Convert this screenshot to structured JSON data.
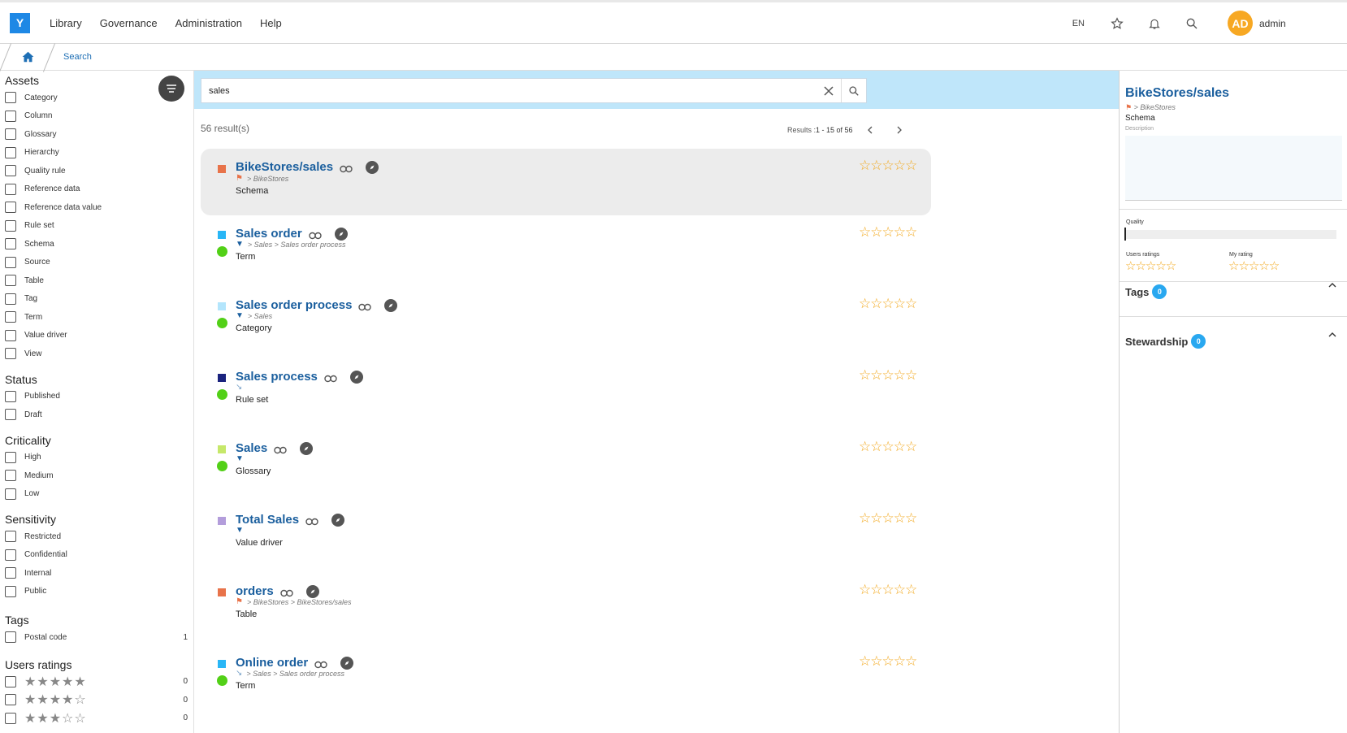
{
  "app": {
    "logo": "Y"
  },
  "menu": [
    "Library",
    "Governance",
    "Administration",
    "Help"
  ],
  "topbar": {
    "language": "EN",
    "avatar_initials": "AD",
    "user": "admin",
    "brand_color": "#1e88e5"
  },
  "breadcrumb": {
    "current": "Search"
  },
  "filters": {
    "groups": [
      {
        "title": "Assets",
        "options": [
          "Category",
          "Column",
          "Glossary",
          "Hierarchy",
          "Quality rule",
          "Reference data",
          "Reference data value",
          "Rule set",
          "Schema",
          "Source",
          "Table",
          "Tag",
          "Term",
          "Value driver",
          "View"
        ]
      },
      {
        "title": "Status",
        "options": [
          "Published",
          "Draft"
        ]
      },
      {
        "title": "Criticality",
        "options": [
          "High",
          "Medium",
          "Low"
        ]
      },
      {
        "title": "Sensitivity",
        "options": [
          "Restricted",
          "Confidential",
          "Internal",
          "Public"
        ]
      }
    ],
    "tags": {
      "title": "Tags",
      "options": [
        {
          "label": "Postal code",
          "count": "1"
        }
      ]
    },
    "users_ratings": {
      "title": "Users ratings",
      "rows": [
        {
          "stars": 5,
          "count": "0"
        },
        {
          "stars": 4,
          "count": "0"
        },
        {
          "stars": 3,
          "count": "0"
        }
      ]
    }
  },
  "search": {
    "value": "sales"
  },
  "results_meta": {
    "count_text": "56 result(s)",
    "pager_prefix": "Results : ",
    "pager_range": "1 - 15 of 56"
  },
  "results": [
    {
      "title": "BikeStores/sales",
      "path": "> BikeStores",
      "type": "Schema",
      "color": "#e8734a",
      "status": false,
      "path_icon": "source-icon"
    },
    {
      "title": "Sales order",
      "path": "> Sales > Sales order process",
      "type": "Term",
      "color": "#29b6f6",
      "status": true,
      "path_icon": "glossary-icon"
    },
    {
      "title": "Sales order process",
      "path": "> Sales",
      "type": "Category",
      "color": "#b3e5fc",
      "status": true,
      "path_icon": "glossary-icon"
    },
    {
      "title": "Sales process",
      "path": "",
      "type": "Rule set",
      "color": "#1a237e",
      "status": true,
      "path_icon": "rule-icon"
    },
    {
      "title": "Sales",
      "path": "",
      "type": "Glossary",
      "color": "#c6e86a",
      "status": true,
      "path_icon": "glossary-icon"
    },
    {
      "title": "Total Sales",
      "path": "",
      "type": "Value driver",
      "color": "#b39ddb",
      "status": false,
      "path_icon": "glossary-icon"
    },
    {
      "title": "orders",
      "path": "> BikeStores > BikeStores/sales",
      "type": "Table",
      "color": "#e8734a",
      "status": false,
      "path_icon": "source-icon"
    },
    {
      "title": "Online order",
      "path": "> Sales > Sales order process",
      "type": "Term",
      "color": "#29b6f6",
      "status": true,
      "path_icon": "rule-icon"
    }
  ],
  "detail": {
    "title": "BikeStores/sales",
    "path": "> BikeStores",
    "type": "Schema",
    "description_label": "Description",
    "quality_label": "Quality",
    "quality_value": 0,
    "users_ratings_label": "Users ratings",
    "my_rating_label": "My rating",
    "tags_title": "Tags",
    "tags_count": "0",
    "stewardship_title": "Stewardship",
    "stewardship_count": "0"
  },
  "colors": {
    "accent": "#1b5f9e",
    "star": "#f2a81d",
    "status_green": "#52d017",
    "search_band": "#bfe6fa",
    "badge": "#29a8f0"
  }
}
